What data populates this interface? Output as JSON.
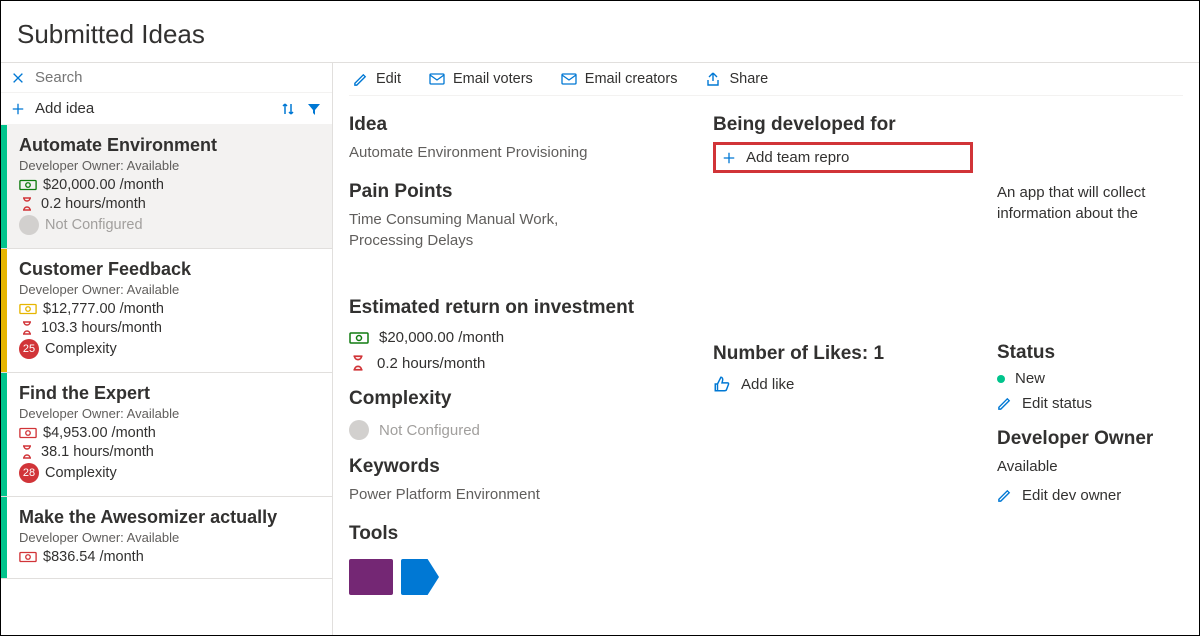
{
  "title": "Submitted Ideas",
  "search": {
    "placeholder": "Search"
  },
  "add_idea_label": "Add idea",
  "sidebar": {
    "items": [
      {
        "title": "Automate Environment",
        "owner": "Developer Owner: Available",
        "cost": "$20,000.00 /month",
        "hours": "0.2 hours/month",
        "complexity": "Not Configured",
        "complexity_muted": true,
        "stripe": "green",
        "selected": true
      },
      {
        "title": "Customer Feedback",
        "owner": "Developer Owner: Available",
        "cost": "$12,777.00 /month",
        "hours": "103.3 hours/month",
        "complexity": "Complexity",
        "complexity_badge": "25",
        "stripe": "yellow",
        "selected": false
      },
      {
        "title": "Find the Expert",
        "owner": "Developer Owner: Available",
        "cost": "$4,953.00 /month",
        "hours": "38.1 hours/month",
        "complexity": "Complexity",
        "complexity_badge": "28",
        "stripe": "green",
        "selected": false
      },
      {
        "title": "Make the Awesomizer actually",
        "owner": "Developer Owner: Available",
        "cost": "$836.54 /month",
        "hours": "",
        "complexity": "",
        "stripe": "green",
        "selected": false
      }
    ]
  },
  "toolbar": {
    "edit": "Edit",
    "email_voters": "Email voters",
    "email_creators": "Email creators",
    "share": "Share"
  },
  "detail": {
    "idea_label": "Idea",
    "idea_value": "Automate Environment Provisioning",
    "pain_label": "Pain Points",
    "pain_value": "Time Consuming Manual Work, Processing Delays",
    "roi_label": "Estimated return on investment",
    "roi_cost": "$20,000.00 /month",
    "roi_hours": "0.2 hours/month",
    "complexity_label": "Complexity",
    "complexity_value": "Not Configured",
    "keywords_label": "Keywords",
    "keywords_value": "Power Platform Environment",
    "tools_label": "Tools",
    "dev_for_label": "Being developed for",
    "add_team": "Add team repro",
    "desc": "An app that will collect information about the",
    "likes_label": "Number of Likes: 1",
    "add_like": "Add like",
    "status_label": "Status",
    "status_value": "New",
    "edit_status": "Edit status",
    "dev_owner_label": "Developer Owner",
    "dev_owner_value": "Available",
    "edit_dev_owner": "Edit dev owner"
  },
  "colors": {
    "money_green": "#107c10",
    "hour_red": "#d13438",
    "money_yellow": "#e6b500"
  }
}
